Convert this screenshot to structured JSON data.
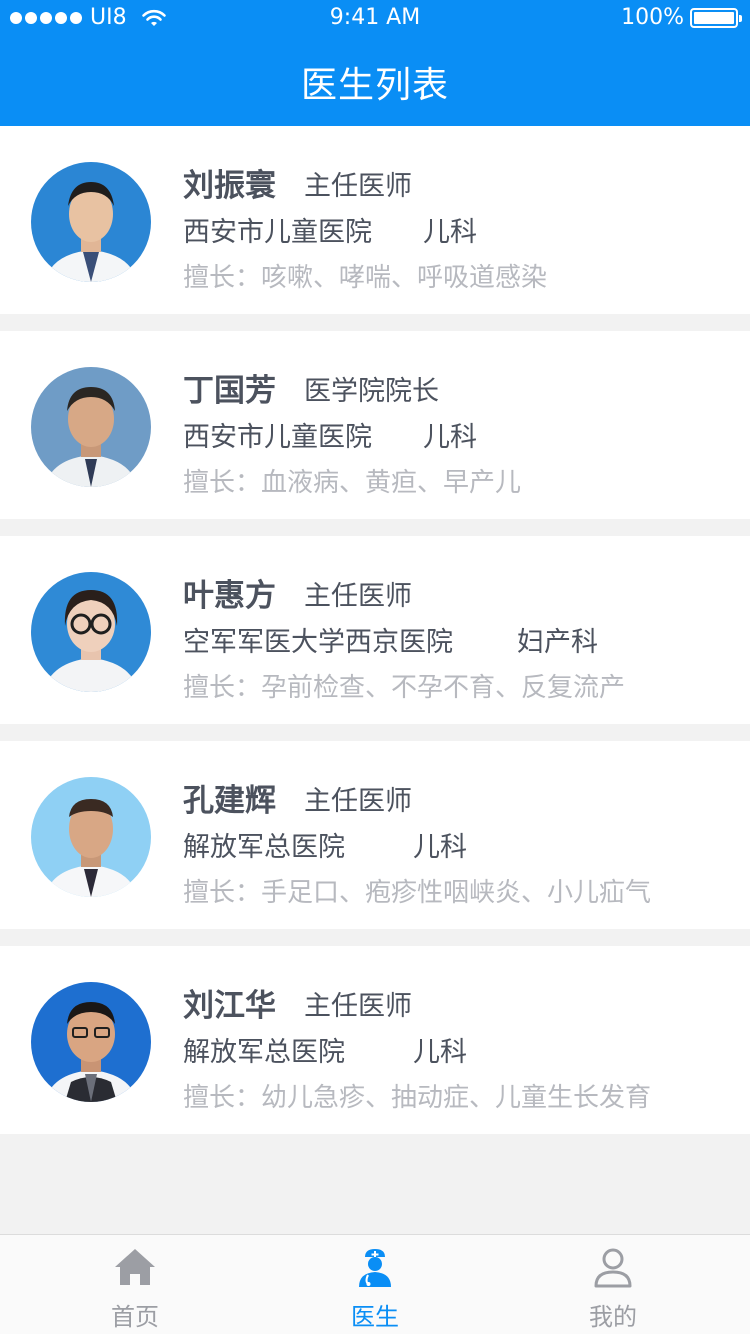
{
  "status_bar": {
    "carrier": "UI8",
    "time": "9:41 AM",
    "battery": "100%"
  },
  "header": {
    "title": "医生列表"
  },
  "doctors": [
    {
      "name": "刘振寰",
      "title": "主任医师",
      "hospital": "西安市儿童医院",
      "department": "儿科",
      "specialty": "擅长：咳嗽、哮喘、呼吸道感染"
    },
    {
      "name": "丁国芳",
      "title": "医学院院长",
      "hospital": "西安市儿童医院",
      "department": "儿科",
      "specialty": "擅长：血液病、黄疸、早产儿"
    },
    {
      "name": "叶惠方",
      "title": "主任医师",
      "hospital": "空军军医大学西京医院",
      "department": "妇产科",
      "specialty": "擅长：孕前检查、不孕不育、反复流产"
    },
    {
      "name": "孔建辉",
      "title": "主任医师",
      "hospital": "解放军总医院",
      "department": "儿科",
      "specialty": "擅长：手足口、疱疹性咽峡炎、小儿疝气"
    },
    {
      "name": "刘江华",
      "title": "主任医师",
      "hospital": "解放军总医院",
      "department": "儿科",
      "specialty": "擅长：幼儿急疹、抽动症、儿童生长发育"
    }
  ],
  "tabs": [
    {
      "label": "首页",
      "icon": "home-icon",
      "active": false
    },
    {
      "label": "医生",
      "icon": "doctor-icon",
      "active": true
    },
    {
      "label": "我的",
      "icon": "user-icon",
      "active": false
    }
  ],
  "colors": {
    "brand": "#0a8ef5",
    "text_primary": "#4c525e",
    "text_muted": "#b7b9bf",
    "tab_inactive": "#9c9ea4"
  }
}
